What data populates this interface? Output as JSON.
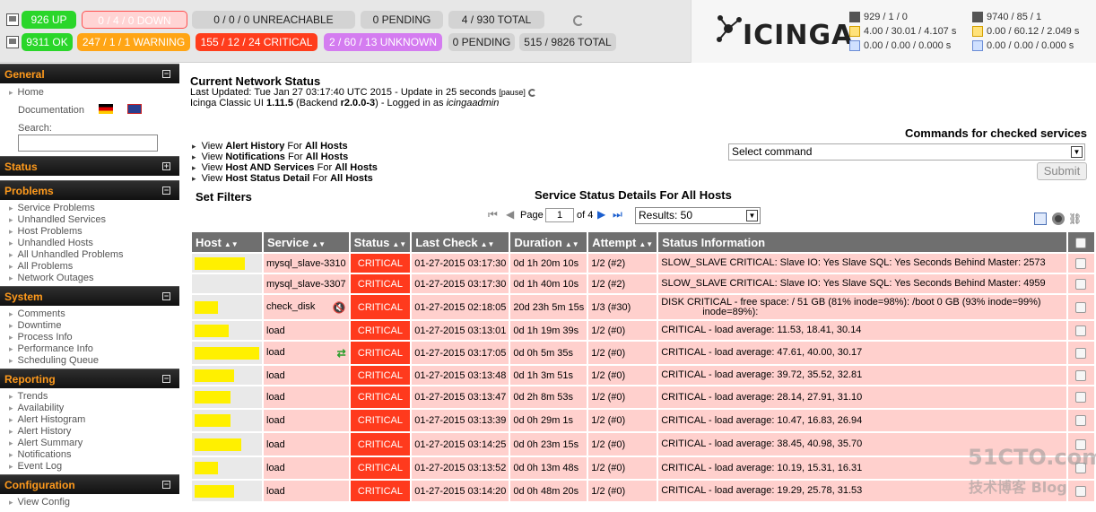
{
  "topbar": {
    "hosts": {
      "up": "926 UP",
      "down_a": "0",
      "down_b": "4",
      "down_c": "0 DOWN",
      "unreachable": "0 / 0 / 0 UNREACHABLE",
      "pending": "0 PENDING",
      "total": "4 / 930 TOTAL"
    },
    "services": {
      "ok": "9311 OK",
      "warning_a": "247",
      "warning_b": "1",
      "warning_c": "1 WARNING",
      "critical_a": "155",
      "critical_b": "12",
      "critical_c": "24 CRITICAL",
      "unknown_a": "2",
      "unknown_b": "60",
      "unknown_c": "13 UNKNOWN",
      "pending": "0 PENDING",
      "total": "515 / 9826 TOTAL"
    },
    "logo": "ICINGA",
    "stats": {
      "host_checks": "929 / 1 / 0",
      "host_latency": "4.00 / 30.01 / 4.107 s",
      "host_exec": "0.00 / 0.00 / 0.000 s",
      "svc_checks": "9740 / 85 / 1",
      "svc_latency": "0.00 / 60.12 / 2.049 s",
      "svc_exec": "0.00 / 0.00 / 0.000 s"
    }
  },
  "sidebar": {
    "general": {
      "title": "General",
      "home": "Home",
      "documentation": "Documentation",
      "search_label": "Search:"
    },
    "status": {
      "title": "Status"
    },
    "problems": {
      "title": "Problems",
      "items": [
        "Service Problems",
        "Unhandled Services",
        "Host Problems",
        "Unhandled Hosts",
        "All Unhandled Problems",
        "All Problems",
        "Network Outages"
      ]
    },
    "system": {
      "title": "System",
      "items": [
        "Comments",
        "Downtime",
        "Process Info",
        "Performance Info",
        "Scheduling Queue"
      ]
    },
    "reporting": {
      "title": "Reporting",
      "items": [
        "Trends",
        "Availability",
        "Alert Histogram",
        "Alert History",
        "Alert Summary",
        "Notifications",
        "Event Log"
      ]
    },
    "configuration": {
      "title": "Configuration",
      "items": [
        "View Config"
      ]
    }
  },
  "main": {
    "title": "Current Network Status",
    "last_updated": "Last Updated: Tue Jan 27 03:17:40 UTC 2015 - Update in 25 seconds",
    "pause": "[pause]",
    "version_prefix": "Icinga Classic UI",
    "version": "1.11.5",
    "backend_prefix": "(Backend",
    "backend": "r2.0.0-3",
    "logged_in": ") - Logged in as",
    "user": "icingaadmin",
    "view_links": [
      {
        "pre": "View",
        "bold": "Alert History",
        "mid": "For",
        "bold2": "All Hosts"
      },
      {
        "pre": "View",
        "bold": "Notifications",
        "mid": "For",
        "bold2": "All Hosts"
      },
      {
        "pre": "View",
        "bold": "Host AND Services",
        "mid": "For",
        "bold2": "All Hosts"
      },
      {
        "pre": "View",
        "bold": "Host Status Detail",
        "mid": "For",
        "bold2": "All Hosts"
      }
    ],
    "commands_title": "Commands for checked services",
    "command_select": "Select command",
    "submit": "Submit",
    "set_filters": "Set Filters",
    "table_title": "Service Status Details For All Hosts",
    "page_label": "Page",
    "page_value": "1",
    "of_label": "of 4",
    "results": "Results: 50",
    "columns": [
      "Host",
      "Service",
      "Status",
      "Last Check",
      "Duration",
      "Attempt",
      "Status Information"
    ],
    "rows": [
      {
        "service": "mysql_slave-3310",
        "status": "CRITICAL",
        "last": "01-27-2015 03:17:30",
        "dur": "0d 1h 20m 10s",
        "att": "1/2 (#2)",
        "info": "SLOW_SLAVE CRITICAL: Slave IO: Yes Slave SQL: Yes Seconds Behind Master: 2573",
        "icon": ""
      },
      {
        "service": "mysql_slave-3307",
        "status": "CRITICAL",
        "last": "01-27-2015 03:17:30",
        "dur": "0d 1h 40m 10s",
        "att": "1/2 (#2)",
        "info": "SLOW_SLAVE CRITICAL: Slave IO: Yes Slave SQL: Yes Seconds Behind Master: 4959",
        "icon": ""
      },
      {
        "service": "check_disk",
        "status": "CRITICAL",
        "last": "01-27-2015 02:18:05",
        "dur": "20d 23h 5m 15s",
        "att": "1/3 (#30)",
        "info": "DISK CRITICAL - free space: / 51 GB (81% inode=98%): /boot 0 GB (93% inode=99%)",
        "info2": "inode=89%):",
        "icon": "mute"
      },
      {
        "service": "load",
        "status": "CRITICAL",
        "last": "01-27-2015 03:13:01",
        "dur": "0d 1h 19m 39s",
        "att": "1/2 (#0)",
        "info": "CRITICAL - load average: 11.53, 18.41, 30.14",
        "icon": ""
      },
      {
        "service": "load",
        "status": "CRITICAL",
        "last": "01-27-2015 03:17:05",
        "dur": "0d 0h 5m 35s",
        "att": "1/2 (#0)",
        "info": "CRITICAL - load average: 47.61, 40.00, 30.17",
        "icon": "flap"
      },
      {
        "service": "load",
        "status": "CRITICAL",
        "last": "01-27-2015 03:13:48",
        "dur": "0d 1h 3m 51s",
        "att": "1/2 (#0)",
        "info": "CRITICAL - load average: 39.72, 35.52, 32.81",
        "icon": ""
      },
      {
        "service": "load",
        "status": "CRITICAL",
        "last": "01-27-2015 03:13:47",
        "dur": "0d 2h 8m 53s",
        "att": "1/2 (#0)",
        "info": "CRITICAL - load average: 28.14, 27.91, 31.10",
        "icon": ""
      },
      {
        "service": "load",
        "status": "CRITICAL",
        "last": "01-27-2015 03:13:39",
        "dur": "0d 0h 29m 1s",
        "att": "1/2 (#0)",
        "info": "CRITICAL - load average: 10.47, 16.83, 26.94",
        "icon": ""
      },
      {
        "service": "load",
        "status": "CRITICAL",
        "last": "01-27-2015 03:14:25",
        "dur": "0d 0h 23m 15s",
        "att": "1/2 (#0)",
        "info": "CRITICAL - load average: 38.45, 40.98, 35.70",
        "icon": ""
      },
      {
        "service": "load",
        "status": "CRITICAL",
        "last": "01-27-2015 03:13:52",
        "dur": "0d 0h 13m 48s",
        "att": "1/2 (#0)",
        "info": "CRITICAL - load average: 10.19, 15.31, 16.31",
        "icon": ""
      },
      {
        "service": "load",
        "status": "CRITICAL",
        "last": "01-27-2015 03:14:20",
        "dur": "0d 0h 48m 20s",
        "att": "1/2 (#0)",
        "info": "CRITICAL - load average: 19.29, 25.78, 31.53",
        "icon": ""
      }
    ]
  },
  "watermark": "51CTO.com",
  "watermark2": "技术博客 Blog",
  "colors": {
    "critical": "#ff3a1d",
    "row_bg": "#ffd0cd",
    "sidebar_head": "#ff9a1c"
  }
}
